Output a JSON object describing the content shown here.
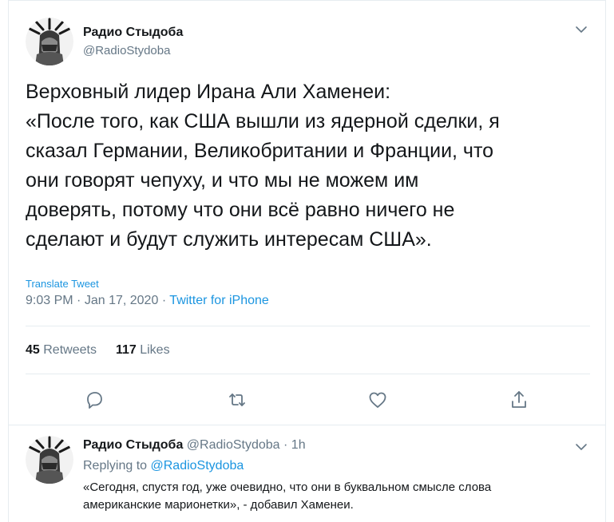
{
  "tweet": {
    "author_name": "Радио Стыдоба",
    "author_handle": "@RadioStydoba",
    "body_lines": [
      "Верховный лидер Ирана Али Хаменеи:",
      "«После того, как США вышли из ядерной сделки, я",
      "сказал Германии, Великобритании и Франции, что",
      "они говорят чепуху, и что мы не можем им",
      "доверять, потому что они всё равно ничего не",
      "сделают и будут служить интересам США»."
    ],
    "translate_label": "Translate Tweet",
    "time": "9:03 PM",
    "date": "Jan 17, 2020",
    "separator": "·",
    "source": "Twitter for iPhone",
    "retweets_count": "45",
    "retweets_label": "Retweets",
    "likes_count": "117",
    "likes_label": "Likes"
  },
  "reply": {
    "author_name": "Радио Стыдоба",
    "author_handle": "@RadioStydoba",
    "separator": "·",
    "age": "1h",
    "replying_prefix": "Replying to",
    "replying_handle": "@RadioStydoba",
    "text_lines": [
      "«Сегодня, спустя год, уже очевидно, что они в буквальном смысле слова",
      "американские марионетки», - добавил Хаменеи."
    ]
  },
  "icons": {
    "chevron": "chevron-down-icon",
    "reply": "reply-icon",
    "retweet": "retweet-icon",
    "like": "heart-icon",
    "share": "share-icon"
  },
  "colors": {
    "link": "#1b95e0",
    "muted": "#657786",
    "text": "#14171a",
    "divider": "#e6ecf0"
  }
}
